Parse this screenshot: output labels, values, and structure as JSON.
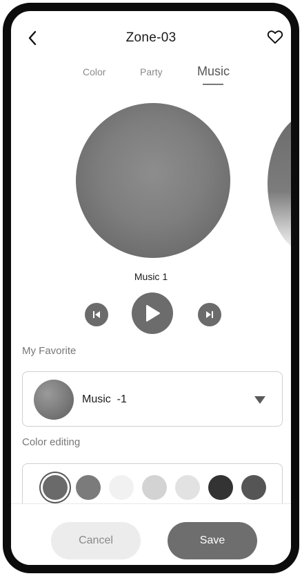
{
  "header": {
    "title": "Zone-03",
    "back_icon": "chevron-left-icon",
    "favorite_icon": "heart-outline-icon"
  },
  "tabs": [
    {
      "label": "Color",
      "active": false
    },
    {
      "label": "Party",
      "active": false
    },
    {
      "label": "Music",
      "active": true
    }
  ],
  "player": {
    "track_name": "Music 1",
    "prev_icon": "skip-previous-icon",
    "play_icon": "play-icon",
    "next_icon": "skip-next-icon"
  },
  "favorite": {
    "label": "My Favorite",
    "selected": "Music  -1"
  },
  "color_editing": {
    "label": "Color editing",
    "swatches": [
      "#6a6a6a",
      "#7b7b7b",
      "#f1f1f1",
      "#d3d3d3",
      "#e2e2e2",
      "#333333",
      "#555555"
    ],
    "selected_index": 0
  },
  "actions": {
    "cancel": "Cancel",
    "save": "Save"
  }
}
